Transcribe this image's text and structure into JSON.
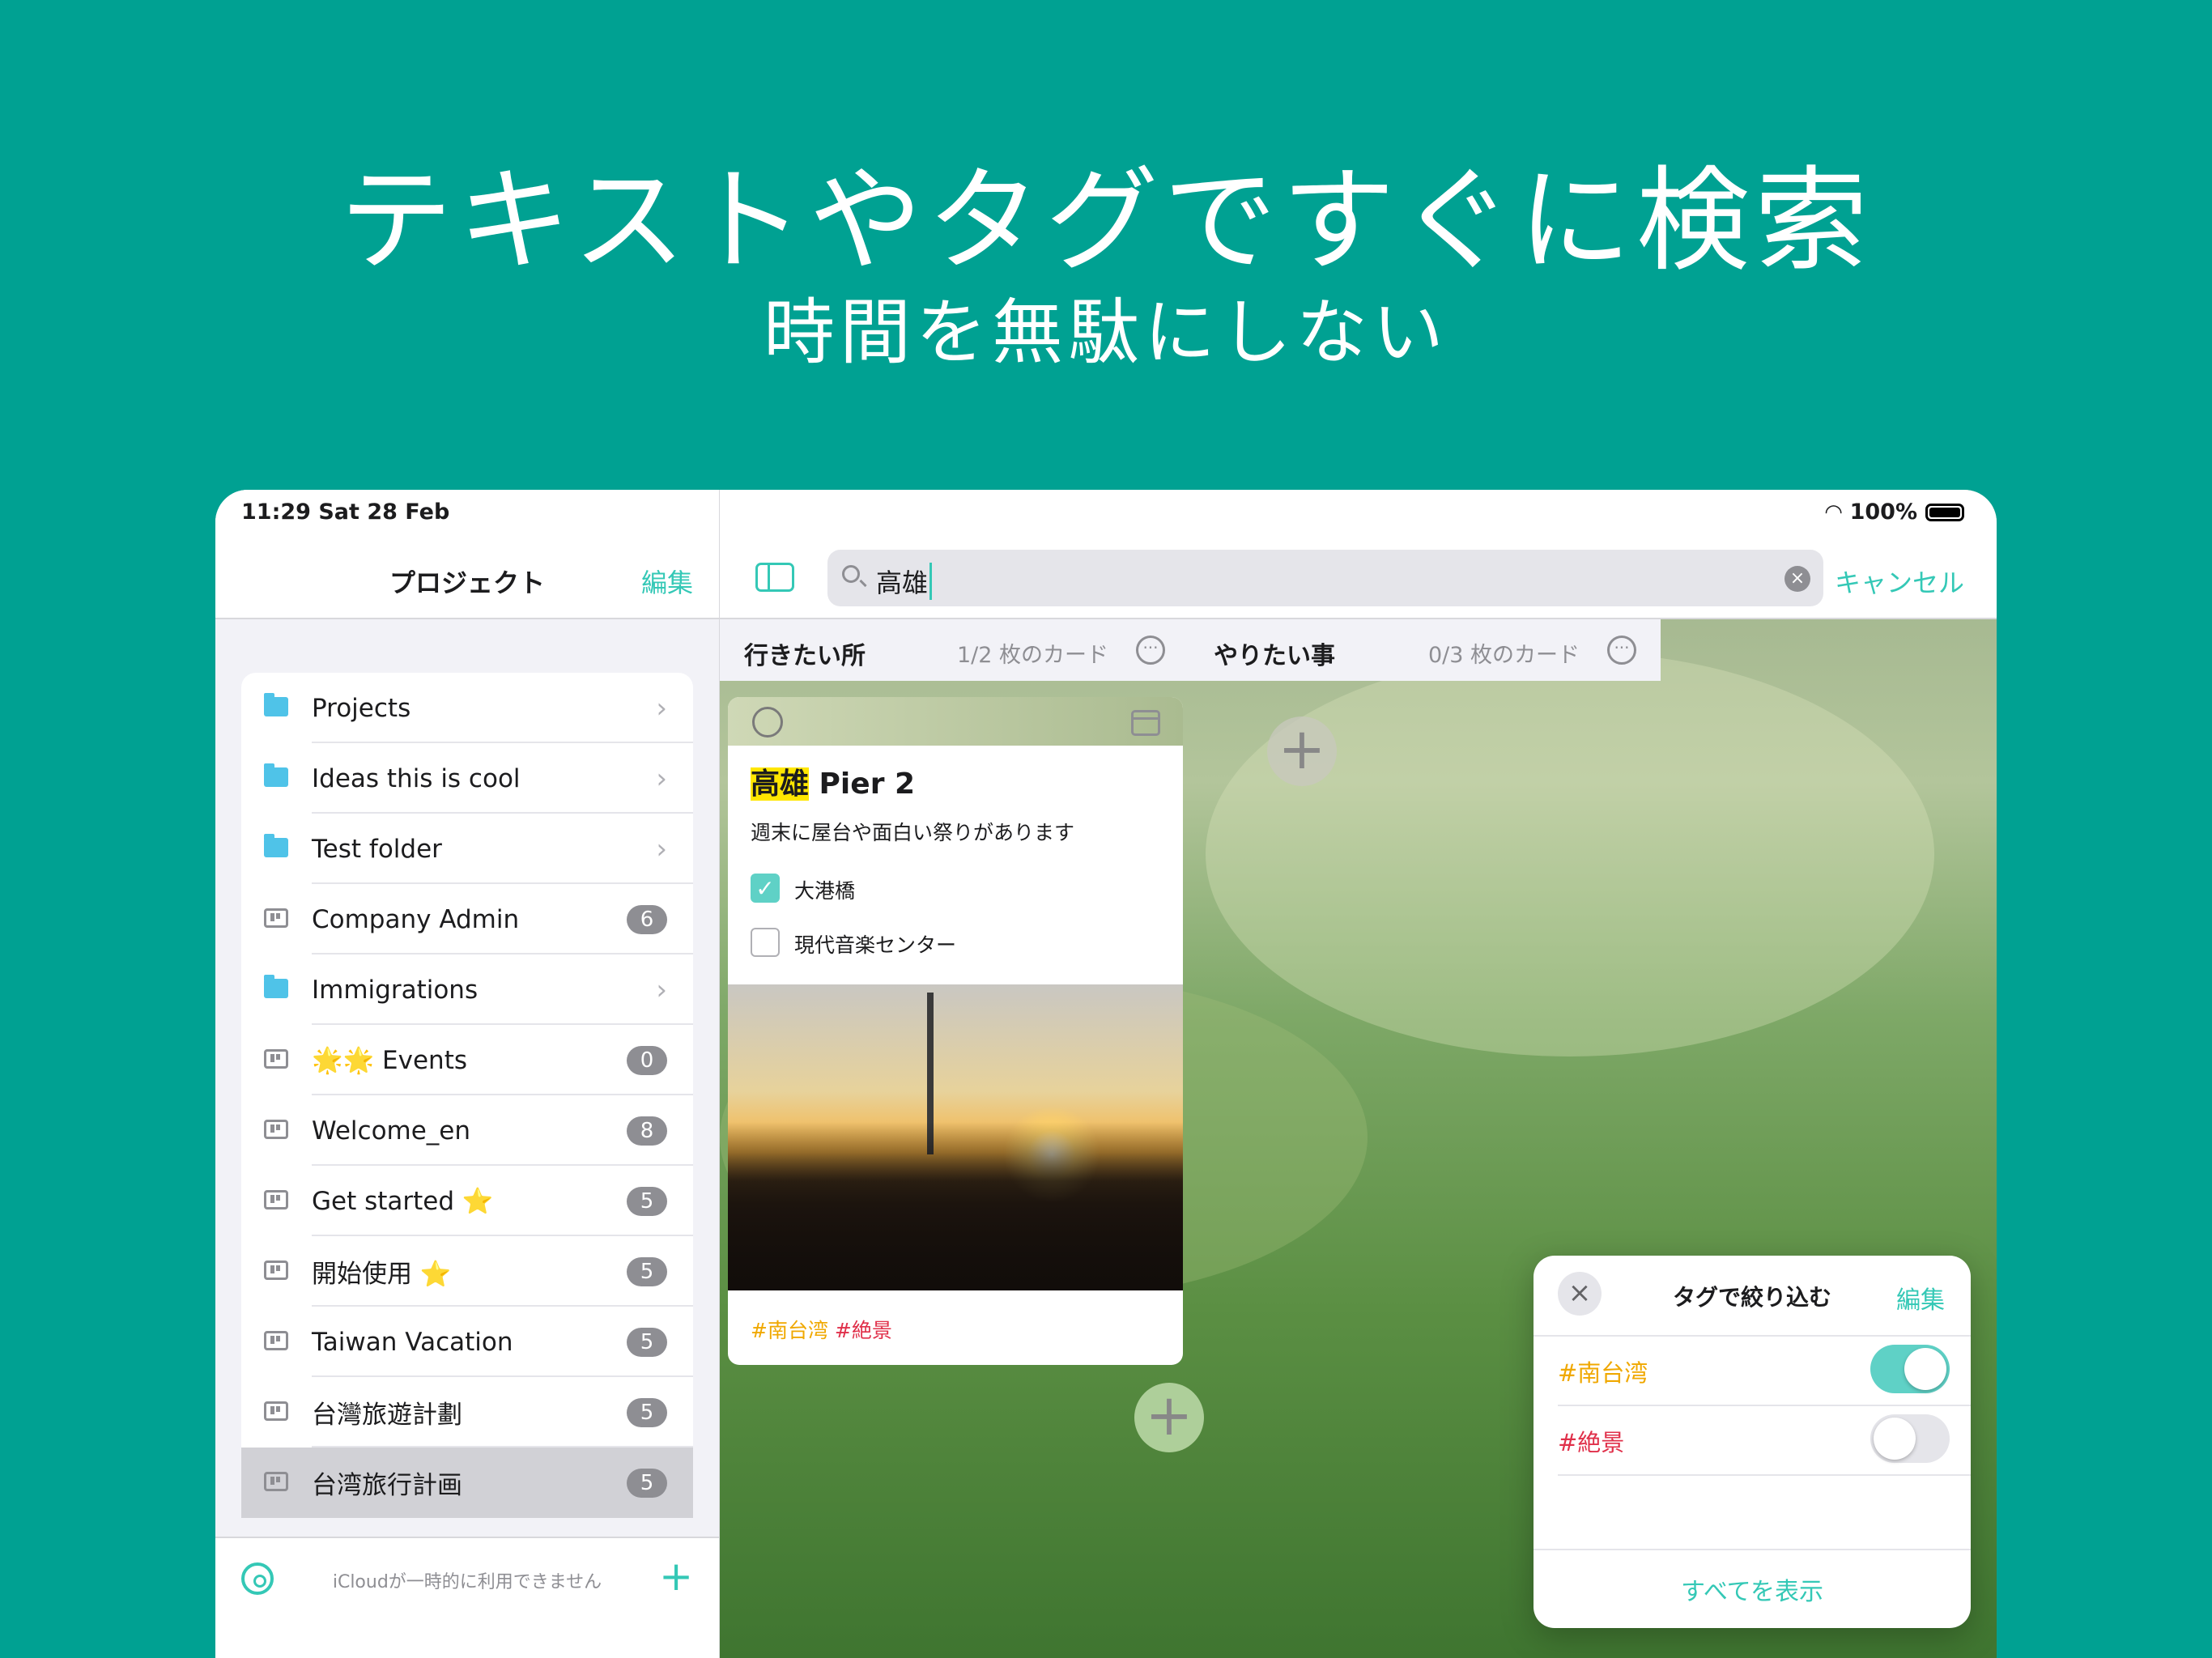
{
  "hero": {
    "title": "テキストやタグですぐに検索",
    "subtitle": "時間を無駄にしない"
  },
  "status": {
    "time": "11:29 Sat 28 Feb",
    "battery": "100%"
  },
  "sidebar": {
    "title": "プロジェクト",
    "edit": "編集",
    "items": [
      {
        "label": "Projects",
        "icon": "folder-icon",
        "badge": null
      },
      {
        "label": "Ideas this is cool",
        "icon": "folder-icon",
        "badge": null
      },
      {
        "label": "Test folder",
        "icon": "folder-icon",
        "badge": null
      },
      {
        "label": "Company Admin",
        "icon": "board-icon",
        "badge": "6"
      },
      {
        "label": "Immigrations",
        "icon": "folder-icon",
        "badge": null
      },
      {
        "label": "🌟🌟 Events",
        "icon": "board-icon",
        "badge": "0"
      },
      {
        "label": "Welcome_en",
        "icon": "board-icon",
        "badge": "8"
      },
      {
        "label": "Get started ⭐",
        "icon": "board-icon",
        "badge": "5"
      },
      {
        "label": "開始使用 ⭐",
        "icon": "board-icon",
        "badge": "5"
      },
      {
        "label": "Taiwan Vacation",
        "icon": "board-icon",
        "badge": "5"
      },
      {
        "label": "台灣旅遊計劃",
        "icon": "board-icon",
        "badge": "5"
      },
      {
        "label": "台湾旅行計画",
        "icon": "board-icon",
        "badge": "5",
        "selected": true
      }
    ],
    "footer_text": "iCloudが一時的に利用できません"
  },
  "search": {
    "query": "高雄",
    "cancel": "キャンセル"
  },
  "columns": [
    {
      "title": "行きたい所",
      "count": "1/2 枚のカード"
    },
    {
      "title": "やりたい事",
      "count": "0/3 枚のカード"
    }
  ],
  "card": {
    "title_highlight": "高雄",
    "title_rest": " Pier 2",
    "description": "週末に屋台や面白い祭りがあります",
    "checklist": [
      {
        "label": "大港橋",
        "checked": true
      },
      {
        "label": "現代音楽センター",
        "checked": false
      }
    ],
    "tags": [
      "#南台湾",
      "#絶景"
    ]
  },
  "filter": {
    "title": "タグで絞り込む",
    "edit": "編集",
    "tags": [
      {
        "label": "#南台湾",
        "on": true,
        "color": "#f0a800"
      },
      {
        "label": "#絶景",
        "on": false,
        "color": "#e0304a"
      }
    ],
    "show_all": "すべてを表示"
  }
}
